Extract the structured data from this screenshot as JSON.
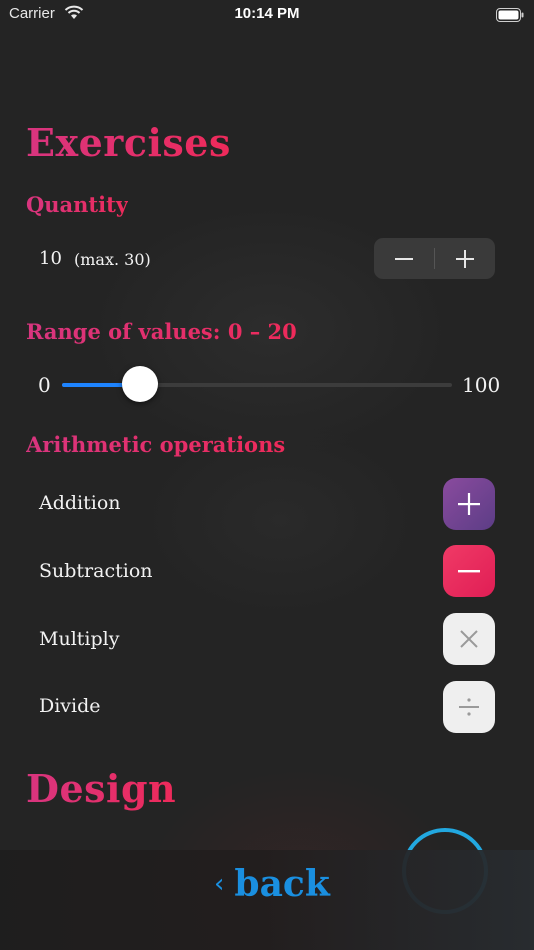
{
  "status_bar": {
    "carrier": "Carrier",
    "time": "10:14 PM"
  },
  "exercises": {
    "title": "Exercises",
    "quantity": {
      "label": "Quantity",
      "value": "10",
      "max_text": "(max. 30)"
    },
    "range": {
      "label": "Range of values: 0 – 20",
      "min_label": "0",
      "max_label": "100",
      "current_max": 20,
      "slider_min": 0,
      "slider_max": 100
    },
    "operations": {
      "label": "Arithmetic operations",
      "items": [
        {
          "label": "Addition",
          "icon": "plus-icon",
          "enabled": true
        },
        {
          "label": "Subtraction",
          "icon": "minus-icon",
          "enabled": true
        },
        {
          "label": "Multiply",
          "icon": "times-icon",
          "enabled": false
        },
        {
          "label": "Divide",
          "icon": "divide-icon",
          "enabled": false
        }
      ]
    }
  },
  "design": {
    "title": "Design"
  },
  "footer": {
    "back_label": "back",
    "back_icon": "chevron-left-icon"
  },
  "colors": {
    "accent_pink": "#e8336f",
    "accent_blue": "#1e84ff",
    "background": "#242424"
  }
}
